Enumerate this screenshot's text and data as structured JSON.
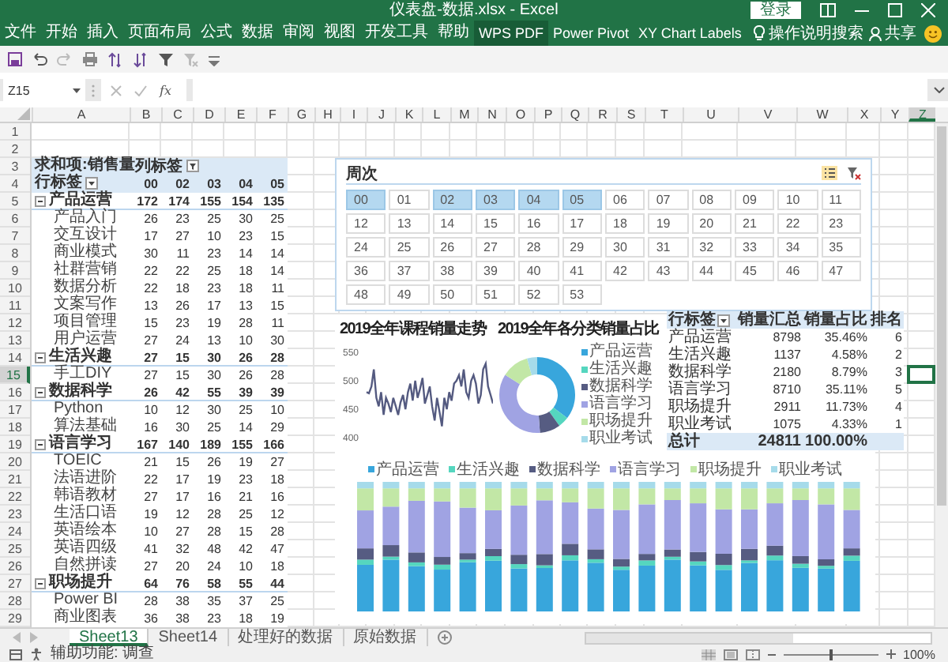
{
  "window": {
    "title": "仪表盘-数据.xlsx  -  Excel",
    "sign_in": "登录"
  },
  "ribbon_tabs": [
    {
      "label": "文件",
      "selected": false
    },
    {
      "label": "开始",
      "selected": false
    },
    {
      "label": "插入",
      "selected": false
    },
    {
      "label": "页面布局",
      "selected": false
    },
    {
      "label": "公式",
      "selected": false
    },
    {
      "label": "数据",
      "selected": false
    },
    {
      "label": "审阅",
      "selected": false
    },
    {
      "label": "视图",
      "selected": false
    },
    {
      "label": "开发工具",
      "selected": false
    },
    {
      "label": "帮助",
      "selected": false
    },
    {
      "label": "WPS PDF",
      "selected": true
    },
    {
      "label": "Power Pivot",
      "selected": false
    },
    {
      "label": "XY Chart Labels",
      "selected": false
    }
  ],
  "tell_me": "操作说明搜索",
  "share": "共享",
  "formula_bar": {
    "name_box": "Z15",
    "fx": "fx"
  },
  "column_headers": [
    {
      "label": "A",
      "selected": false
    },
    {
      "label": "B",
      "selected": false
    },
    {
      "label": "C",
      "selected": false
    },
    {
      "label": "D",
      "selected": false
    },
    {
      "label": "E",
      "selected": false
    },
    {
      "label": "F",
      "selected": false
    },
    {
      "label": "G",
      "selected": false
    },
    {
      "label": "H",
      "selected": false
    },
    {
      "label": "I",
      "selected": false
    },
    {
      "label": "J",
      "selected": false
    },
    {
      "label": "K",
      "selected": false
    },
    {
      "label": "L",
      "selected": false
    },
    {
      "label": "M",
      "selected": false
    },
    {
      "label": "N",
      "selected": false
    },
    {
      "label": "O",
      "selected": false
    },
    {
      "label": "P",
      "selected": false
    },
    {
      "label": "Q",
      "selected": false
    },
    {
      "label": "R",
      "selected": false
    },
    {
      "label": "S",
      "selected": false
    },
    {
      "label": "T",
      "selected": false
    },
    {
      "label": "U",
      "selected": false
    },
    {
      "label": "V",
      "selected": false
    },
    {
      "label": "W",
      "selected": false
    },
    {
      "label": "X",
      "selected": false
    },
    {
      "label": "Y",
      "selected": false
    },
    {
      "label": "Z",
      "selected": true
    }
  ],
  "row_headers": [
    {
      "label": "1",
      "selected": false
    },
    {
      "label": "2",
      "selected": false
    },
    {
      "label": "3",
      "selected": false
    },
    {
      "label": "4",
      "selected": false
    },
    {
      "label": "5",
      "selected": false
    },
    {
      "label": "6",
      "selected": false
    },
    {
      "label": "7",
      "selected": false
    },
    {
      "label": "8",
      "selected": false
    },
    {
      "label": "9",
      "selected": false
    },
    {
      "label": "10",
      "selected": false
    },
    {
      "label": "11",
      "selected": false
    },
    {
      "label": "12",
      "selected": false
    },
    {
      "label": "13",
      "selected": false
    },
    {
      "label": "14",
      "selected": false
    },
    {
      "label": "15",
      "selected": true
    },
    {
      "label": "16",
      "selected": false
    },
    {
      "label": "17",
      "selected": false
    },
    {
      "label": "18",
      "selected": false
    },
    {
      "label": "19",
      "selected": false
    },
    {
      "label": "20",
      "selected": false
    },
    {
      "label": "21",
      "selected": false
    },
    {
      "label": "22",
      "selected": false
    },
    {
      "label": "23",
      "selected": false
    },
    {
      "label": "24",
      "selected": false
    },
    {
      "label": "25",
      "selected": false
    },
    {
      "label": "26",
      "selected": false
    },
    {
      "label": "27",
      "selected": false
    },
    {
      "label": "28",
      "selected": false
    },
    {
      "label": "29",
      "selected": false
    }
  ],
  "pivot": {
    "value_field": "求和项:销售量",
    "column_labels": "列标签",
    "row_labels": "行标签",
    "columns": [
      "00",
      "02",
      "03",
      "04",
      "05"
    ],
    "groups": [
      {
        "name": "产品运营",
        "expanded": true,
        "values": [
          "172",
          "174",
          "155",
          "154",
          "135"
        ],
        "children": [
          {
            "name": "产品入门",
            "values": [
              "26",
              "23",
              "25",
              "30",
              "25"
            ]
          },
          {
            "name": "交互设计",
            "values": [
              "17",
              "27",
              "10",
              "23",
              "15"
            ]
          },
          {
            "name": "商业模式",
            "values": [
              "30",
              "11",
              "23",
              "14",
              "14"
            ]
          },
          {
            "name": "社群营销",
            "values": [
              "22",
              "22",
              "25",
              "18",
              "14"
            ]
          },
          {
            "name": "数据分析",
            "values": [
              "22",
              "18",
              "23",
              "18",
              "11"
            ]
          },
          {
            "name": "文案写作",
            "values": [
              "13",
              "26",
              "17",
              "13",
              "15"
            ]
          },
          {
            "name": "项目管理",
            "values": [
              "15",
              "23",
              "19",
              "28",
              "11"
            ]
          },
          {
            "name": "用户运营",
            "values": [
              "27",
              "24",
              "13",
              "10",
              "30"
            ]
          }
        ]
      },
      {
        "name": "生活兴趣",
        "expanded": true,
        "values": [
          "27",
          "15",
          "30",
          "26",
          "28"
        ],
        "children": [
          {
            "name": "手工DIY",
            "values": [
              "27",
              "15",
              "30",
              "26",
              "28"
            ]
          }
        ]
      },
      {
        "name": "数据科学",
        "expanded": true,
        "values": [
          "26",
          "42",
          "55",
          "39",
          "39"
        ],
        "children": [
          {
            "name": "Python",
            "values": [
              "10",
              "12",
              "30",
              "25",
              "10"
            ]
          },
          {
            "name": "算法基础",
            "values": [
              "16",
              "30",
              "25",
              "14",
              "29"
            ]
          }
        ]
      },
      {
        "name": "语言学习",
        "expanded": true,
        "values": [
          "167",
          "140",
          "189",
          "155",
          "166"
        ],
        "children": [
          {
            "name": "TOEIC",
            "values": [
              "21",
              "15",
              "26",
              "19",
              "27"
            ]
          },
          {
            "name": "法语进阶",
            "values": [
              "22",
              "17",
              "19",
              "23",
              "18"
            ]
          },
          {
            "name": "韩语教材",
            "values": [
              "27",
              "17",
              "16",
              "21",
              "16"
            ]
          },
          {
            "name": "生活口语",
            "values": [
              "19",
              "12",
              "28",
              "25",
              "12"
            ]
          },
          {
            "name": "英语绘本",
            "values": [
              "10",
              "27",
              "28",
              "15",
              "28"
            ]
          },
          {
            "name": "英语四级",
            "values": [
              "41",
              "32",
              "48",
              "42",
              "47"
            ]
          },
          {
            "name": "自然拼读",
            "values": [
              "27",
              "20",
              "24",
              "10",
              "18"
            ]
          }
        ]
      },
      {
        "name": "职场提升",
        "expanded": true,
        "values": [
          "64",
          "76",
          "58",
          "55",
          "44"
        ],
        "children": [
          {
            "name": "Power BI",
            "values": [
              "28",
              "38",
              "35",
              "37",
              "25"
            ]
          },
          {
            "name": "商业图表",
            "values": [
              "36",
              "38",
              "23",
              "18",
              "19"
            ]
          }
        ]
      }
    ]
  },
  "slicer": {
    "title": "周次",
    "items": [
      {
        "label": "00",
        "selected": true
      },
      {
        "label": "01",
        "selected": false
      },
      {
        "label": "02",
        "selected": true
      },
      {
        "label": "03",
        "selected": true
      },
      {
        "label": "04",
        "selected": true
      },
      {
        "label": "05",
        "selected": true
      },
      {
        "label": "06",
        "selected": false
      },
      {
        "label": "07",
        "selected": false
      },
      {
        "label": "08",
        "selected": false
      },
      {
        "label": "09",
        "selected": false
      },
      {
        "label": "10",
        "selected": false
      },
      {
        "label": "11",
        "selected": false
      },
      {
        "label": "12",
        "selected": false
      },
      {
        "label": "13",
        "selected": false
      },
      {
        "label": "14",
        "selected": false
      },
      {
        "label": "15",
        "selected": false
      },
      {
        "label": "16",
        "selected": false
      },
      {
        "label": "17",
        "selected": false
      },
      {
        "label": "18",
        "selected": false
      },
      {
        "label": "19",
        "selected": false
      },
      {
        "label": "20",
        "selected": false
      },
      {
        "label": "21",
        "selected": false
      },
      {
        "label": "22",
        "selected": false
      },
      {
        "label": "23",
        "selected": false
      },
      {
        "label": "24",
        "selected": false
      },
      {
        "label": "25",
        "selected": false
      },
      {
        "label": "26",
        "selected": false
      },
      {
        "label": "27",
        "selected": false
      },
      {
        "label": "28",
        "selected": false
      },
      {
        "label": "29",
        "selected": false
      },
      {
        "label": "30",
        "selected": false
      },
      {
        "label": "31",
        "selected": false
      },
      {
        "label": "32",
        "selected": false
      },
      {
        "label": "33",
        "selected": false
      },
      {
        "label": "34",
        "selected": false
      },
      {
        "label": "35",
        "selected": false
      },
      {
        "label": "36",
        "selected": false
      },
      {
        "label": "37",
        "selected": false
      },
      {
        "label": "38",
        "selected": false
      },
      {
        "label": "39",
        "selected": false
      },
      {
        "label": "40",
        "selected": false
      },
      {
        "label": "41",
        "selected": false
      },
      {
        "label": "42",
        "selected": false
      },
      {
        "label": "43",
        "selected": false
      },
      {
        "label": "44",
        "selected": false
      },
      {
        "label": "45",
        "selected": false
      },
      {
        "label": "46",
        "selected": false
      },
      {
        "label": "47",
        "selected": false
      },
      {
        "label": "48",
        "selected": false
      },
      {
        "label": "49",
        "selected": false
      },
      {
        "label": "50",
        "selected": false
      },
      {
        "label": "51",
        "selected": false
      },
      {
        "label": "52",
        "selected": false
      },
      {
        "label": "53",
        "selected": false
      }
    ]
  },
  "line_chart": {
    "chart_data": {
      "type": "line",
      "title": "2019全年课程销量走势",
      "ylim": [
        400,
        550
      ],
      "yticks": [
        400,
        450,
        500,
        550
      ],
      "series": [
        {
          "color": "#545a80",
          "values": [
            480,
            478,
            490,
            520,
            470,
            455,
            480,
            440,
            470,
            460,
            445,
            470,
            455,
            440,
            462,
            475,
            450,
            480,
            495,
            465,
            500,
            470,
            485,
            505,
            460,
            475,
            490,
            455,
            430,
            470,
            445,
            420,
            470,
            450,
            480,
            465,
            495,
            500,
            510,
            490,
            520,
            480,
            470,
            500,
            510,
            495,
            460,
            475,
            520,
            530,
            490,
            475,
            460
          ]
        }
      ]
    }
  },
  "donut_chart": {
    "title": "2019全年各分类销量占比",
    "legend": [
      {
        "label": "产品运营",
        "color": "#38a6dc"
      },
      {
        "label": "生活兴趣",
        "color": "#55d6bf"
      },
      {
        "label": "数据科学",
        "color": "#565c82"
      },
      {
        "label": "语言学习",
        "color": "#a0a3e3"
      },
      {
        "label": "职场提升",
        "color": "#c2e7a6"
      },
      {
        "label": "职业考试",
        "color": "#a6dbea"
      }
    ]
  },
  "summary": {
    "headers": [
      "行标签",
      "销量汇总",
      "销量占比",
      "排名"
    ],
    "rows": [
      {
        "category": "产品运营",
        "total": "8798",
        "share": "35.46%",
        "rank": "6"
      },
      {
        "category": "生活兴趣",
        "total": "1137",
        "share": "4.58%",
        "rank": "2"
      },
      {
        "category": "数据科学",
        "total": "2180",
        "share": "8.79%",
        "rank": "3"
      },
      {
        "category": "语言学习",
        "total": "8710",
        "share": "35.11%",
        "rank": "5"
      },
      {
        "category": "职场提升",
        "total": "2911",
        "share": "11.73%",
        "rank": "4"
      },
      {
        "category": "职业考试",
        "total": "1075",
        "share": "4.33%",
        "rank": "1"
      }
    ],
    "total_row": {
      "label": "总计",
      "total": "24811",
      "share": "100.00%"
    }
  },
  "bar_chart": {
    "legend": [
      {
        "label": "产品运营",
        "color": "#38a6dc"
      },
      {
        "label": "生活兴趣",
        "color": "#55d6bf"
      },
      {
        "label": "数据科学",
        "color": "#565c82"
      },
      {
        "label": "语言学习",
        "color": "#a0a3e3"
      },
      {
        "label": "职场提升",
        "color": "#c2e7a6"
      },
      {
        "label": "职业考试",
        "color": "#a6dbea"
      }
    ]
  },
  "sheet_tabs": [
    {
      "label": "Sheet13",
      "selected": true
    },
    {
      "label": "Sheet14",
      "selected": false
    },
    {
      "label": "处理好的数据",
      "selected": false
    },
    {
      "label": "原始数据",
      "selected": false
    }
  ],
  "status": {
    "accessibility": "辅助功能: 调查",
    "zoom": "100%",
    "zoom_slider": {
      "level": 0.5
    }
  }
}
